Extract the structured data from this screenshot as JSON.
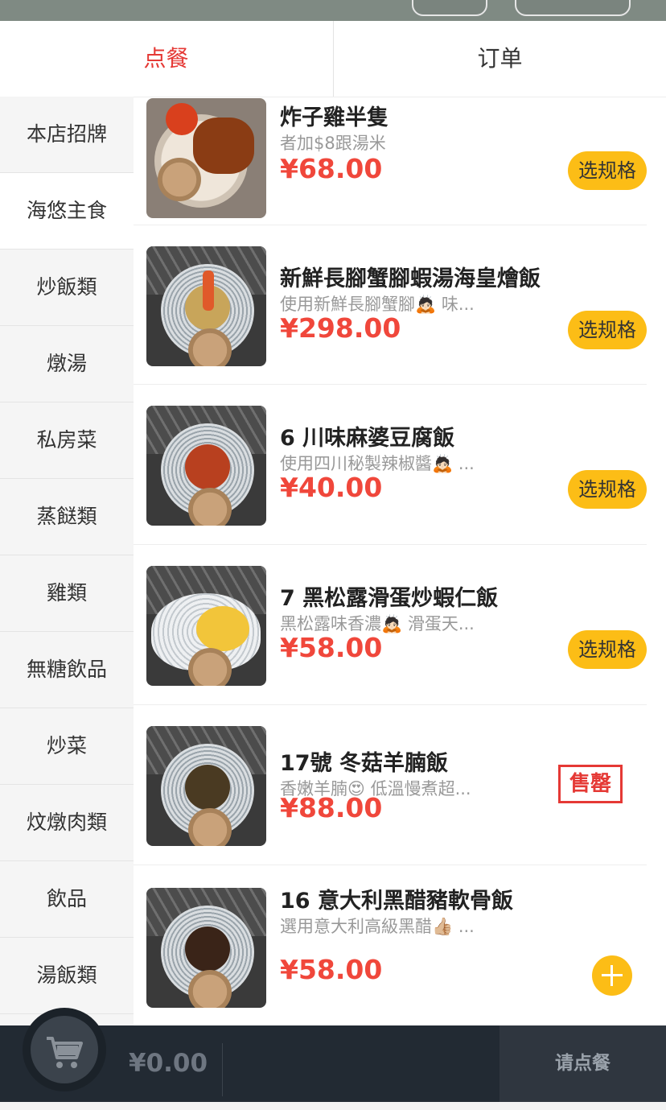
{
  "tabs": [
    {
      "label": "点餐"
    },
    {
      "label": "订单"
    }
  ],
  "categories": [
    {
      "label": "本店招牌"
    },
    {
      "label": "海悠主食"
    },
    {
      "label": "炒飯類"
    },
    {
      "label": "燉湯"
    },
    {
      "label": "私房菜"
    },
    {
      "label": "蒸餸類"
    },
    {
      "label": "雞類"
    },
    {
      "label": "無糖飲品"
    },
    {
      "label": "炒菜"
    },
    {
      "label": "炆燉肉類"
    },
    {
      "label": "飲品"
    },
    {
      "label": "湯飯類"
    }
  ],
  "items": [
    {
      "name": "炸子雞半隻",
      "desc": "者加$8跟湯米",
      "price": "¥68.00",
      "action": "选规格"
    },
    {
      "name": "新鮮長腳蟹腳蝦湯海皇燴飯",
      "desc": "使用新鮮長腳蟹腳🙇🏻 味...",
      "price": "¥298.00",
      "action": "选规格"
    },
    {
      "name": "6 川味麻婆豆腐飯",
      "desc": "使用四川秘製辣椒醬🙇🏻 ...",
      "price": "¥40.00",
      "action": "选规格"
    },
    {
      "name": "7 黑松露滑蛋炒蝦仁飯",
      "desc": "黑松露味香濃🙇🏻 滑蛋天...",
      "price": "¥58.00",
      "action": "选规格"
    },
    {
      "name": "17號 冬菇羊腩飯",
      "desc": "香嫩羊腩😍 低溫慢煮超...",
      "price": "¥88.00",
      "action": "售罄"
    },
    {
      "name": "16 意大利黑醋豬軟骨飯",
      "desc": "選用意大利高級黑醋👍🏼 ...",
      "price": "¥58.00",
      "action": "add"
    }
  ],
  "cart": {
    "total": "¥0.00",
    "checkout_label": "请点餐",
    "icon": "cart-icon"
  },
  "colors": {
    "accent_red": "#e53935",
    "price_red": "#f0473b",
    "button_yellow": "#fcbd16",
    "cart_bar": "#222a33"
  }
}
